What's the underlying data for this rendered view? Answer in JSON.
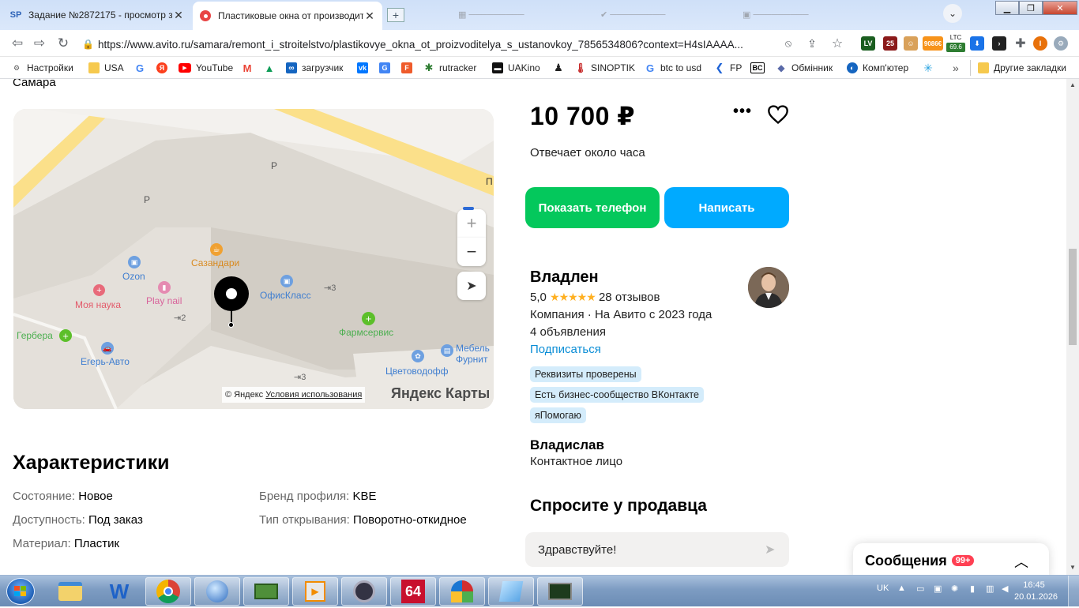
{
  "browser": {
    "tabs": [
      {
        "title": "Задание №2872175 - просмотр з",
        "favicon": "SP",
        "active": false
      },
      {
        "title": "Пластиковые окна от производит",
        "favicon": "avito-icon",
        "active": true
      }
    ],
    "url": "https://www.avito.ru/samara/remont_i_stroitelstvo/plastikovye_okna_ot_proizvoditelya_s_ustanovkoy_7856534806?context=H4sIAAAA...",
    "extensions": {
      "ltc_label": "LTC",
      "ltc_value": "69.6",
      "counter": "25",
      "price_badge": "9086€",
      "lv": "LV"
    },
    "bookmarks": [
      {
        "label": "Настройки",
        "icon": "gear-icon"
      },
      {
        "label": "USA",
        "icon": "folder-icon"
      },
      {
        "label": "",
        "icon": "google-icon"
      },
      {
        "label": "",
        "icon": "yandex-icon"
      },
      {
        "label": "YouTube",
        "icon": "youtube-icon"
      },
      {
        "label": "",
        "icon": "gmail-icon"
      },
      {
        "label": "",
        "icon": "drive-icon"
      },
      {
        "label": "загрузчик",
        "icon": "infinity-icon"
      },
      {
        "label": "",
        "icon": "vk-icon"
      },
      {
        "label": "",
        "icon": "translate-icon"
      },
      {
        "label": "",
        "icon": "f-icon"
      },
      {
        "label": "rutracker",
        "icon": "rutracker-icon"
      },
      {
        "label": "UAKino",
        "icon": "uakino-icon"
      },
      {
        "label": "",
        "icon": "figure-icon"
      },
      {
        "label": "SINOPTIK",
        "icon": "thermometer-icon"
      },
      {
        "label": "btc to usd",
        "icon": "google-icon"
      },
      {
        "label": "FP",
        "icon": "fp-icon"
      },
      {
        "label": "",
        "icon": "bc-icon"
      },
      {
        "label": "Обмінник",
        "icon": "exchange-icon"
      },
      {
        "label": "Комп'ютер",
        "icon": "computer-icon"
      },
      {
        "label": "",
        "icon": "star-icon"
      },
      {
        "label": "Другие закладки",
        "icon": "folder-icon"
      }
    ],
    "more_bookmarks": "»"
  },
  "listing": {
    "city": "Самара",
    "map": {
      "places": [
        "Сазандари",
        "Ozon",
        "ОфисКласс",
        "Моя наука",
        "Play nail",
        "Гербера",
        "Фармсервис",
        "Егерь-Авто",
        "Мебель Фурнит",
        "Цветоводофф"
      ],
      "parking": "P",
      "entrances": [
        "3",
        "2",
        "3"
      ],
      "street_fragment": "П",
      "copyright": "© Яндекс",
      "terms": "Условия использования",
      "logo": "Яндекс Карты"
    },
    "price": "10 700 ₽",
    "responds": "Отвечает около часа",
    "show_phone": "Показать телефон",
    "write": "Написать",
    "seller": {
      "name": "Владлен",
      "rating": "5,0",
      "stars": 5,
      "reviews": "28 отзывов",
      "type": "Компания · На Авито с 2023 года",
      "ads": "4 объявления",
      "subscribe": "Подписаться",
      "badges": [
        "Реквизиты проверены",
        "Есть бизнес-сообщество ВКонтакте",
        "яПомогаю"
      ],
      "contact_name": "Владислав",
      "contact_role": "Контактное лицо"
    },
    "characteristics": {
      "title": "Характеристики",
      "items": [
        {
          "key": "Состояние:",
          "value": "Новое"
        },
        {
          "key": "Доступность:",
          "value": "Под заказ"
        },
        {
          "key": "Материал:",
          "value": "Пластик"
        },
        {
          "key": "Бренд профиля:",
          "value": "KBE"
        },
        {
          "key": "Тип открывания:",
          "value": "Поворотно-откидное"
        }
      ]
    },
    "ask": {
      "title": "Спросите у продавца",
      "message": "Здравствуйте!"
    },
    "messages": {
      "label": "Сообщения",
      "count": "99+"
    }
  },
  "taskbar": {
    "lang": "UK",
    "time": "16:45",
    "date": "20.01.2026",
    "counter_app": "64"
  },
  "colors": {
    "green": "#04c85c",
    "blue": "#00aaff",
    "badge_bg": "#d4ecfb",
    "link": "#0a8dd6",
    "star": "#ffb021"
  }
}
